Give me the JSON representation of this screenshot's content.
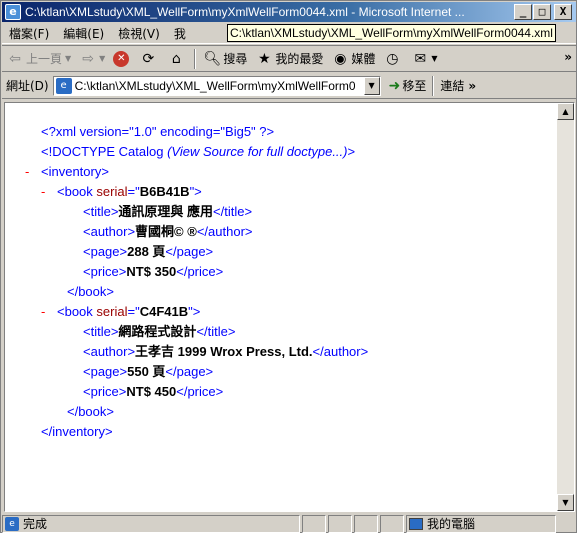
{
  "window": {
    "title": "C:\\ktlan\\XMLstudy\\XML_WellForm\\myXmlWellForm0044.xml - Microsoft Internet ...",
    "buttons": {
      "minimize": "_",
      "maximize": "□",
      "close": "X"
    }
  },
  "menu": {
    "items": [
      "檔案(F)",
      "編輯(E)",
      "檢視(V)",
      "我"
    ],
    "tooltip": "C:\\ktlan\\XMLstudy\\XML_WellForm\\myXmlWellForm0044.xml"
  },
  "toolbar": {
    "back": "上一頁",
    "search": "搜尋",
    "favorites": "我的最愛",
    "media": "媒體",
    "more": "»"
  },
  "address": {
    "label": "網址(D)",
    "value": "C:\\ktlan\\XMLstudy\\XML_WellForm\\myXmlWellForm0044.:",
    "go": "移至",
    "links": "連結",
    "more": "»"
  },
  "document": {
    "xml_decl": "<?xml version=\"1.0\" encoding=\"Big5\" ?>",
    "doctype": "<!DOCTYPE Catalog",
    "doctype_note": "(View Source for full doctype...)",
    "doctype_close": ">",
    "root_tag": "inventory",
    "minus": "-",
    "books": [
      {
        "serial": "B6B41B",
        "title": "通訊原理與  應用",
        "author": "曹國桐© ®",
        "page": "288 頁",
        "price": "NT$ 350"
      },
      {
        "serial": "C4F41B",
        "title": "網路程式設計",
        "author": "王孝吉 1999 Wrox Press, Ltd.",
        "page": "550 頁",
        "price": "NT$ 450"
      }
    ]
  },
  "status": {
    "text": "完成",
    "zone": "我的電腦"
  }
}
